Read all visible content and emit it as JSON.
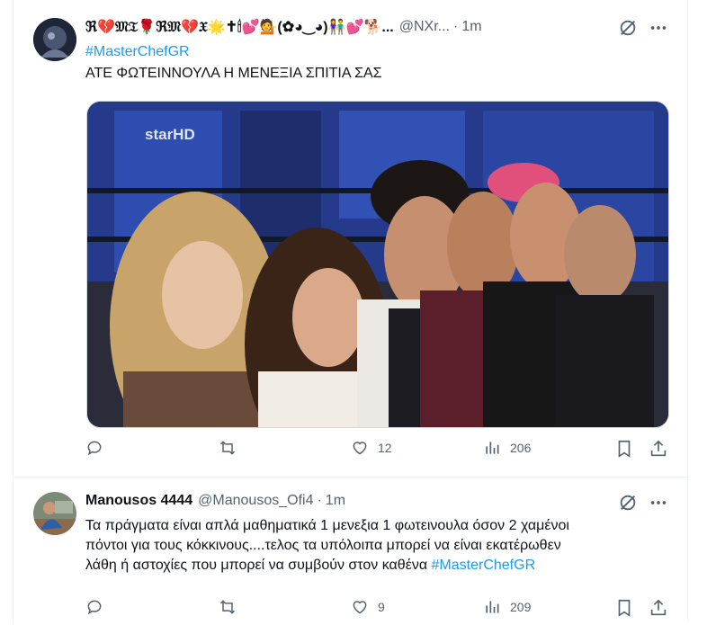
{
  "tweets": [
    {
      "display_name": "ℜ💔𝔐𝔗🌹ℜ𝔐💔𝔛🌟✝🕯💕💁(✿◕‿◕)👫💕🐕...",
      "handle": "@NXr...",
      "separator": "·",
      "time": "1m",
      "hashtag": "#MasterChefGR",
      "text": "ΑΤΕ ΦΩΤΕΙΝΝΟΥΛΑ Η ΜΕΝΕΞΙΑ ΣΠΙΤΙΑ ΣΑΣ",
      "media_watermark": "starHD",
      "replies": "",
      "retweets": "",
      "likes": "12",
      "views": "206"
    },
    {
      "display_name": "Manousos 4444",
      "handle": "@Manousos_Ofi4",
      "separator": "·",
      "time": "1m",
      "text_line1": "Τα πράγματα είναι απλά μαθηματικά 1 μενεξια 1 φωτεινουλα όσον 2 χαμένοι",
      "text_line2": "πόντοι για τους κόκκινους....τελος τα υπόλοιπα μπορεί να είναι εκατέρωθεν",
      "text_line3": "λάθη ή αστοχίες που μπορεί να συμβούν στον καθένα ",
      "hashtag": "#MasterChefGR",
      "replies": "",
      "retweets": "",
      "likes": "9",
      "views": "209"
    }
  ],
  "icons": {
    "reply": "reply-icon",
    "retweet": "retweet-icon",
    "like": "heart-icon",
    "views": "views-icon",
    "bookmark": "bookmark-icon",
    "share": "share-icon",
    "grok": "grok-icon",
    "more": "more-icon"
  },
  "colors": {
    "accent": "#1d9bf0",
    "muted": "#536471",
    "text": "#0f1419"
  }
}
